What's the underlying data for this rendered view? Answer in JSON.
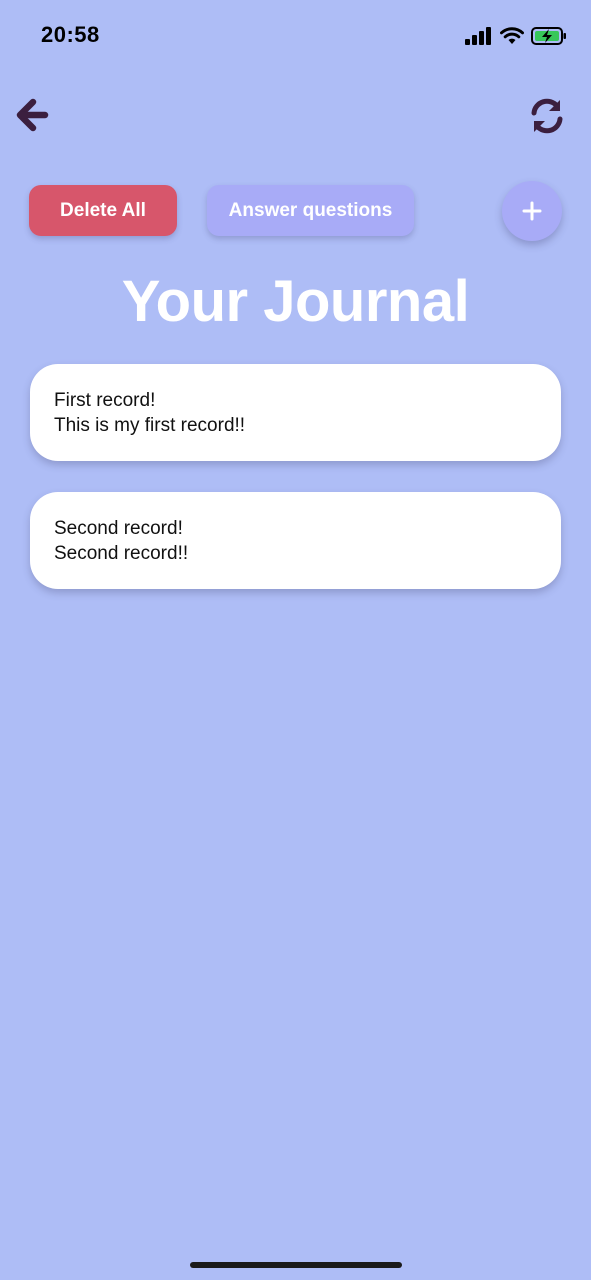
{
  "status_bar": {
    "time": "20:58",
    "icons": [
      "signal-icon",
      "wifi-icon",
      "battery-charging-icon"
    ]
  },
  "nav": {
    "back_icon": "arrow-left-icon",
    "refresh_icon": "refresh-icon"
  },
  "actions": {
    "delete_all_label": "Delete All",
    "answer_questions_label": "Answer questions",
    "add_label": "+"
  },
  "title": "Your Journal",
  "records": [
    {
      "title": "First record!",
      "body": "This is my first record!!"
    },
    {
      "title": "Second record!",
      "body": "Second record!!"
    }
  ],
  "colors": {
    "background": "#aebdf6",
    "delete": "#d7566b",
    "accent": "#a8abf7",
    "icon_dark": "#3b1f3f"
  }
}
